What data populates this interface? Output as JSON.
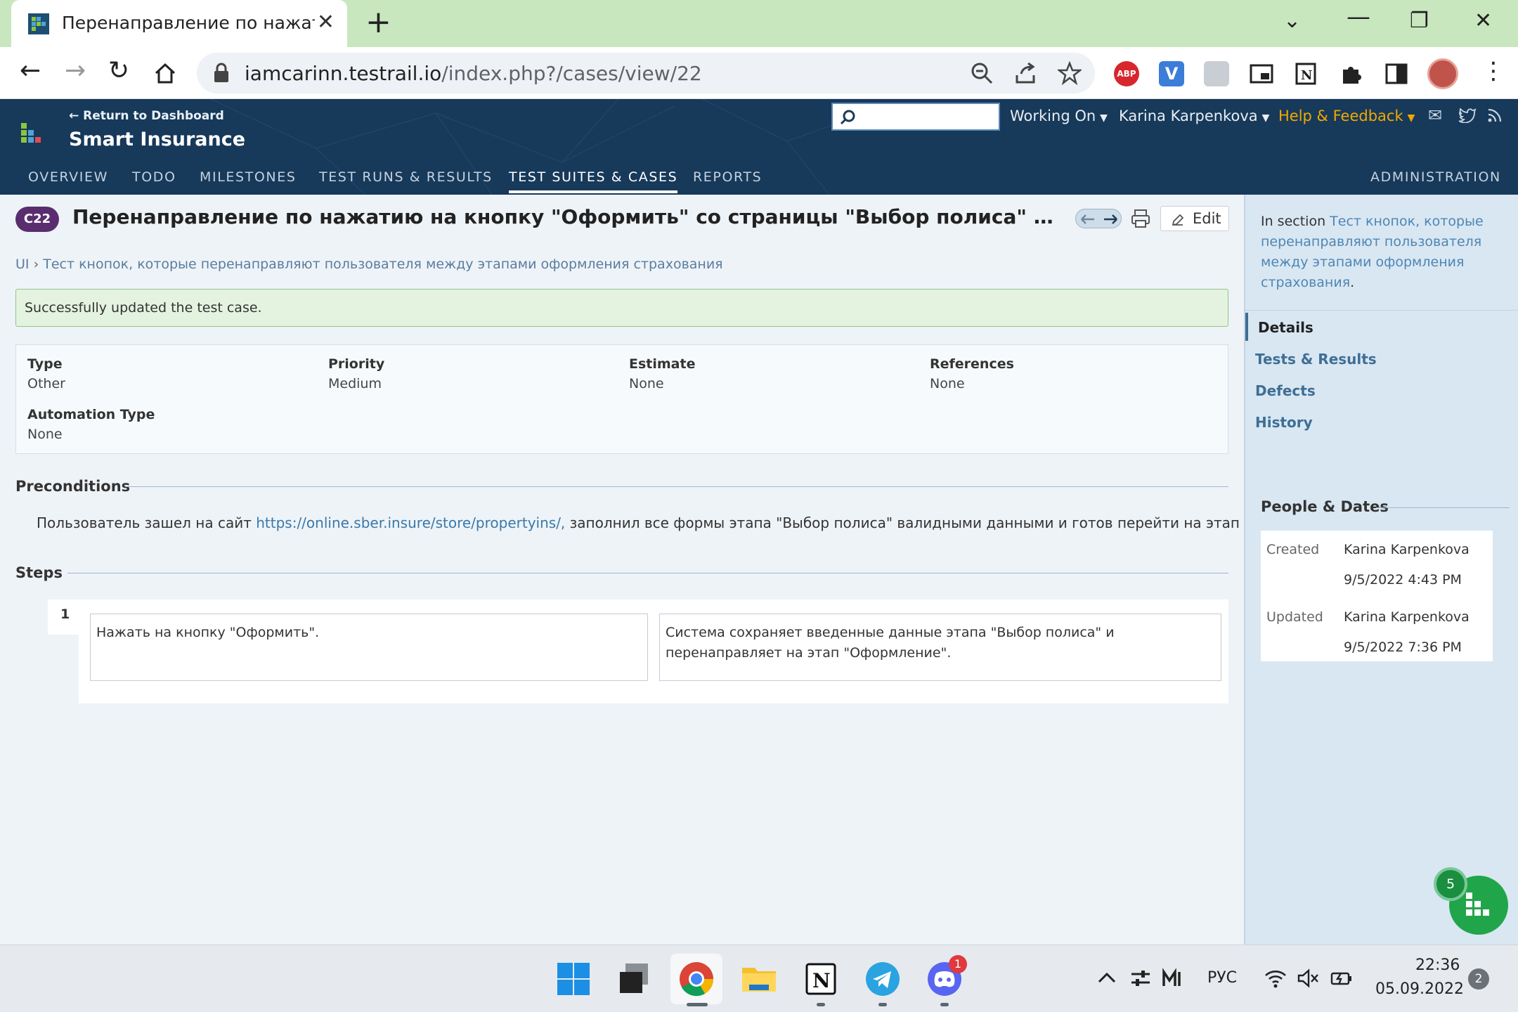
{
  "browser": {
    "tab_title": "Перенаправление по нажатию",
    "url_host": "iamcarinn.testrail.io",
    "url_path": "/index.php?/cases/view/22",
    "extensions": [
      "abp-icon",
      "v-extension-icon",
      "profile-ext-icon",
      "pip-icon",
      "notion-clipper-icon",
      "puzzle-extensions-icon",
      "sidebar-icon",
      "profile-avatar"
    ]
  },
  "app": {
    "back_link": "← Return to Dashboard",
    "project": "Smart Insurance",
    "search_placeholder": "",
    "menu_working_on": "Working On",
    "menu_user": "Karina Karpenkova",
    "menu_help": "Help & Feedback",
    "nav": {
      "overview": "OVERVIEW",
      "todo": "TODO",
      "milestones": "MILESTONES",
      "runs": "TEST RUNS & RESULTS",
      "suites": "TEST SUITES & CASES",
      "reports": "REPORTS",
      "admin": "ADMINISTRATION"
    }
  },
  "case": {
    "id": "C22",
    "title": "Перенаправление по нажатию на кнопку \"Оформить\" со страницы \"Выбор полиса\" на страницу \"Оформление\"",
    "edit_label": "Edit",
    "breadcrumb_root": "UI",
    "breadcrumb_sep": "›",
    "breadcrumb_section": "Тест кнопок, которые перенаправляют пользователя между этапами оформления страхования",
    "alert": "Successfully updated the test case.",
    "fields": {
      "type_label": "Type",
      "type_value": "Other",
      "priority_label": "Priority",
      "priority_value": "Medium",
      "estimate_label": "Estimate",
      "estimate_value": "None",
      "references_label": "References",
      "references_value": "None",
      "automation_label": "Automation Type",
      "automation_value": "None"
    },
    "preconditions_label": "Preconditions",
    "preconditions_before": "Пользователь зашел на сайт ",
    "preconditions_link": "https://online.sber.insure/store/propertyins/,",
    "preconditions_after": " заполнил все формы этапа \"Выбор полиса\" валидными данными и готов перейти на этап \"Оформление\".",
    "steps_label": "Steps",
    "steps": [
      {
        "num": "1",
        "action": "Нажать на кнопку \"Оформить\".",
        "expected": "Система сохраняет введенные данные этапа \"Выбор полиса\" и перенаправляет на этап \"Оформление\"."
      }
    ]
  },
  "sidebar": {
    "in_section_label": "In section",
    "in_section_link": "Тест кнопок, которые перенаправляют пользователя между этапами оформления страхования",
    "in_section_end": ".",
    "nav": {
      "details": "Details",
      "tests_results": "Tests & Results",
      "defects": "Defects",
      "history": "History"
    },
    "people_label": "People & Dates",
    "created_label": "Created",
    "created_by": "Karina Karpenkova",
    "created_at": "9/5/2022 4:43 PM",
    "updated_label": "Updated",
    "updated_by": "Karina Karpenkova",
    "updated_at": "9/5/2022 7:36 PM",
    "fab_badge": "5"
  },
  "taskbar": {
    "apps": [
      "windows-start-icon",
      "task-view-icon",
      "chrome-icon",
      "file-explorer-icon",
      "notion-icon",
      "telegram-icon",
      "discord-icon"
    ],
    "discord_badge": "1",
    "lang": "РУС",
    "time": "22:36",
    "date": "05.09.2022",
    "notifications": "2"
  },
  "colors": {
    "header_bg": "#17395a",
    "accent_help": "#f2a800",
    "badge_purple": "#5a2d6f",
    "success_bg": "#e4f3e0",
    "fab_green": "#21a54a"
  }
}
